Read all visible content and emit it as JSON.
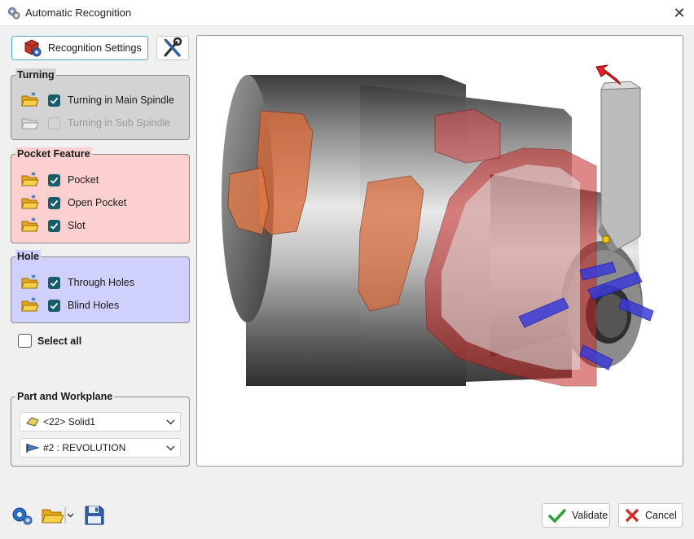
{
  "window": {
    "title": "Automatic Recognition",
    "close_glyph": "✕"
  },
  "toolbar": {
    "settings_label": "Recognition Settings"
  },
  "groups": {
    "turning": {
      "title": "Turning",
      "color": "#d3d3d3",
      "items": [
        {
          "label": "Turning in Main Spindle",
          "checked": true,
          "enabled": true
        },
        {
          "label": "Turning in Sub Spindle",
          "checked": false,
          "enabled": false
        }
      ]
    },
    "pocket": {
      "title": "Pocket Feature",
      "color": "#fdd0d0",
      "items": [
        {
          "label": "Pocket",
          "checked": true
        },
        {
          "label": "Open Pocket",
          "checked": true
        },
        {
          "label": "Slot",
          "checked": true
        }
      ]
    },
    "hole": {
      "title": "Hole",
      "color": "#d0d0fc",
      "items": [
        {
          "label": "Through Holes",
          "checked": true
        },
        {
          "label": "Blind Holes",
          "checked": true
        }
      ]
    }
  },
  "select_all": {
    "label": "Select all",
    "checked": false
  },
  "part_workplane": {
    "title": "Part and Workplane",
    "part_value": "<22> Solid1",
    "workplane_value": "#2 : REVOLUTION"
  },
  "actions": {
    "validate_label": "Validate",
    "cancel_label": "Cancel"
  },
  "icons": {
    "app": "gear-stack-icon",
    "settings": "gear-cube-icon",
    "tools": "wrench-screwdriver-icon",
    "folder": "folder-open-icon",
    "bottom_settings": "gears-icon",
    "bottom_open": "folder-open-icon",
    "save": "floppy-disk-icon",
    "validate": "checkmark-icon",
    "cancel": "x-icon"
  },
  "colors": {
    "accent_check": "#165e6a",
    "validate_green": "#2e9e3a",
    "cancel_red": "#d32f2f"
  }
}
